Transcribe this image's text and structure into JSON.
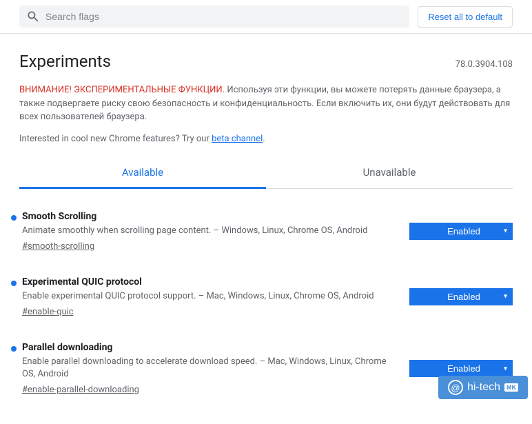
{
  "search": {
    "placeholder": "Search flags"
  },
  "header": {
    "reset_label": "Reset all to default"
  },
  "page": {
    "title": "Experiments",
    "version": "78.0.3904.108",
    "warning_title": "ВНИМАНИЕ! ЭКСПЕРИМЕНТАЛЬНЫЕ ФУНКЦИИ.",
    "warning_body": " Используя эти функции, вы можете потерять данные браузера, а также подвергаете риску свою безопасность и конфиденциальность. Если включить их, они будут действовать для всех пользователей браузера.",
    "promo_prefix": "Interested in cool new Chrome features? Try our ",
    "promo_link": "beta channel",
    "promo_suffix": "."
  },
  "tabs": {
    "available": "Available",
    "unavailable": "Unavailable"
  },
  "experiments": [
    {
      "title": "Smooth Scrolling",
      "desc": "Animate smoothly when scrolling page content. – Windows, Linux, Chrome OS, Android",
      "hash": "#smooth-scrolling",
      "state": "Enabled"
    },
    {
      "title": "Experimental QUIC protocol",
      "desc": "Enable experimental QUIC protocol support. – Mac, Windows, Linux, Chrome OS, Android",
      "hash": "#enable-quic",
      "state": "Enabled"
    },
    {
      "title": "Parallel downloading",
      "desc": "Enable parallel downloading to accelerate download speed. – Mac, Windows, Linux, Chrome OS, Android",
      "hash": "#enable-parallel-downloading",
      "state": "Enabled"
    }
  ],
  "watermark": {
    "text": "hi-tech",
    "badge": "MK"
  }
}
